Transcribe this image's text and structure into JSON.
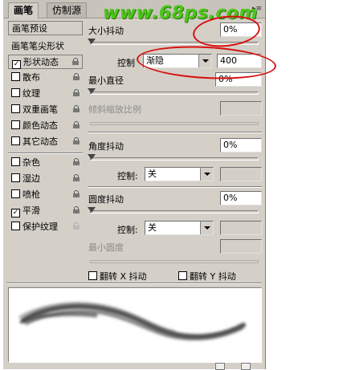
{
  "tabs": [
    {
      "label": "画笔"
    },
    {
      "label": "仿制源"
    }
  ],
  "watermark": "www.68ps.com",
  "sidebar": {
    "presets_label": "画笔预设",
    "tip_shape_label": "画笔笔尖形状",
    "options": [
      {
        "label": "形状动态",
        "checked": true,
        "selected": true,
        "lock": true
      },
      {
        "label": "散布",
        "checked": false,
        "lock": true
      },
      {
        "label": "纹理",
        "checked": false,
        "lock": true
      },
      {
        "label": "双重画笔",
        "checked": false,
        "lock": true
      },
      {
        "label": "颜色动态",
        "checked": false,
        "lock": true
      },
      {
        "label": "其它动态",
        "checked": false,
        "lock": true
      },
      {
        "label": "杂色",
        "checked": false,
        "lock": true
      },
      {
        "label": "湿边",
        "checked": false,
        "lock": true
      },
      {
        "label": "喷枪",
        "checked": false,
        "lock": true
      },
      {
        "label": "平滑",
        "checked": true,
        "lock": true
      },
      {
        "label": "保护纹理",
        "checked": false,
        "lock": true
      }
    ]
  },
  "main": {
    "size_jitter": {
      "label": "大小抖动",
      "value": "0%",
      "level": 0
    },
    "size_control": {
      "label": "控制",
      "value": "渐隐",
      "count": "400"
    },
    "min_diameter": {
      "label": "最小直径",
      "value": "0%",
      "level": 0
    },
    "tilt_scale": {
      "label": "倾斜缩放比例",
      "value": ""
    },
    "angle_jitter": {
      "label": "角度抖动",
      "value": "0%",
      "level": 0
    },
    "angle_control": {
      "label": "控制:",
      "value": "关",
      "extra": ""
    },
    "roundness_jitter": {
      "label": "圆度抖动",
      "value": "0%",
      "level": 0
    },
    "roundness_control": {
      "label": "控制:",
      "value": "关",
      "extra": ""
    },
    "min_roundness": {
      "label": "最小圆度",
      "value": ""
    },
    "flip_x": {
      "label": "翻转 X 抖动",
      "checked": false
    },
    "flip_y": {
      "label": "翻转 Y 抖动",
      "checked": false
    }
  },
  "colors": {
    "annotation": "#d81010",
    "watermark": "#4cc51a",
    "panel_bg": "#d4d0c8"
  }
}
